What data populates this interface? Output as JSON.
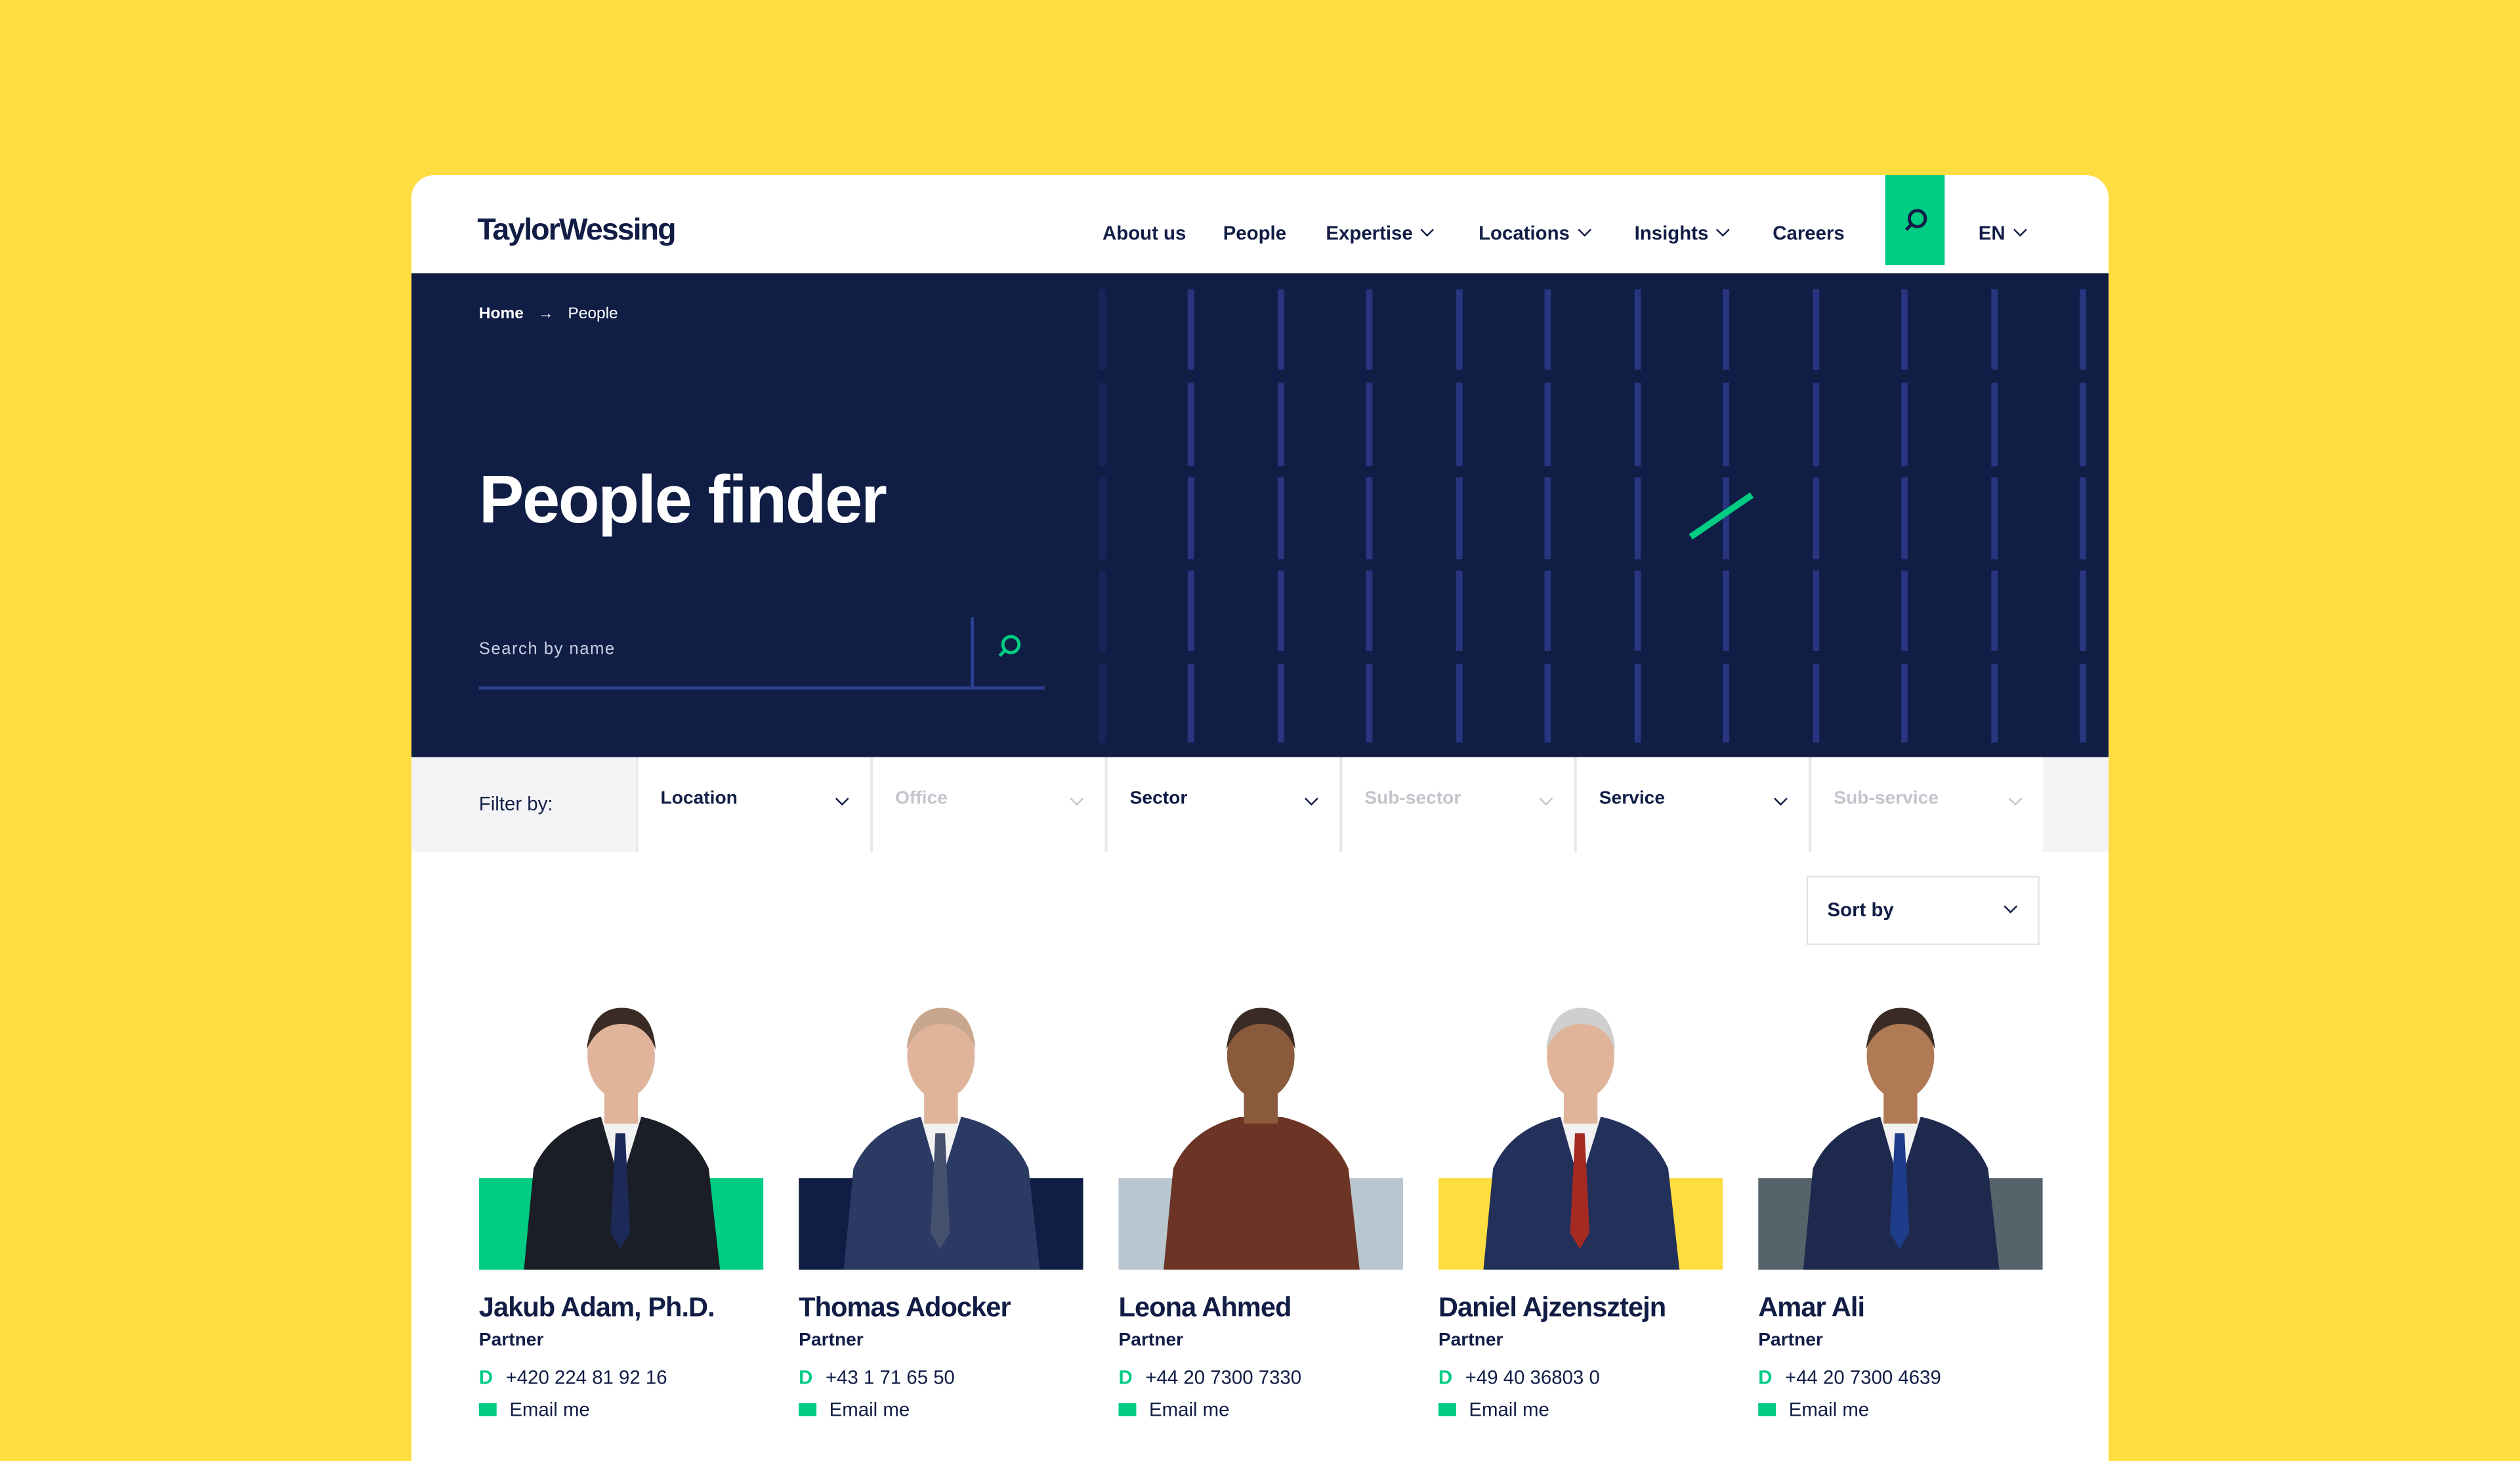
{
  "brand": {
    "logo": "TaylorWessing",
    "accent": "#00cc83",
    "navy": "#101d45",
    "background": "#fddd3f"
  },
  "nav": {
    "items": [
      {
        "label": "About us",
        "dropdown": false
      },
      {
        "label": "People",
        "dropdown": false
      },
      {
        "label": "Expertise",
        "dropdown": true
      },
      {
        "label": "Locations",
        "dropdown": true
      },
      {
        "label": "Insights",
        "dropdown": true
      },
      {
        "label": "Careers",
        "dropdown": false
      }
    ],
    "search_icon": "search-icon",
    "language": "EN"
  },
  "breadcrumb": {
    "home": "Home",
    "separator": "→",
    "current": "People"
  },
  "hero": {
    "title": "People finder",
    "search_placeholder": "Search by name"
  },
  "filters": {
    "label": "Filter by:",
    "selects": [
      {
        "label": "Location",
        "enabled": true
      },
      {
        "label": "Office",
        "enabled": false
      },
      {
        "label": "Sector",
        "enabled": true
      },
      {
        "label": "Sub-sector",
        "enabled": false
      },
      {
        "label": "Service",
        "enabled": true
      },
      {
        "label": "Sub-service",
        "enabled": false
      }
    ]
  },
  "sort": {
    "label": "Sort by"
  },
  "people": [
    {
      "name": "Jakub Adam, Ph.D.",
      "role": "Partner",
      "phone_prefix": "D",
      "phone": "+420 224 81 92 16",
      "email": "Email me",
      "block_color": "#00cc83",
      "suit": "#1b1e26",
      "tie": "#1c2a5a"
    },
    {
      "name": "Thomas Adocker",
      "role": "Partner",
      "phone_prefix": "D",
      "phone": "+43 1 71 65 50",
      "email": "Email me",
      "block_color": "#101d45",
      "suit": "#2a3a63",
      "tie": "#44506e"
    },
    {
      "name": "Leona Ahmed",
      "role": "Partner",
      "phone_prefix": "D",
      "phone": "+44 20 7300 7330",
      "email": "Email me",
      "block_color": "#b8c6d0",
      "suit": "#6b3424",
      "tie": "#6b3424"
    },
    {
      "name": "Daniel Ajzensztejn",
      "role": "Partner",
      "phone_prefix": "D",
      "phone": "+49 40 36803 0",
      "email": "Email me",
      "block_color": "#fddd3f",
      "suit": "#22305a",
      "tie": "#a52a22"
    },
    {
      "name": "Amar Ali",
      "role": "Partner",
      "phone_prefix": "D",
      "phone": "+44 20 7300 4639",
      "email": "Email me",
      "block_color": "#56636b",
      "suit": "#1e2a4d",
      "tie": "#1f3c8a"
    }
  ]
}
